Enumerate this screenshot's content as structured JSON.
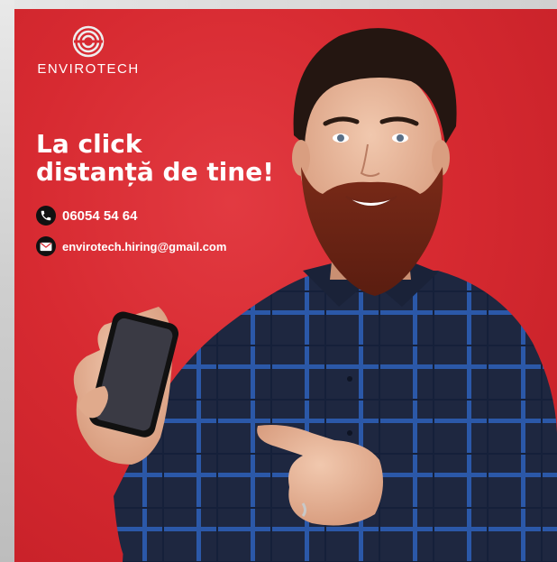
{
  "brand": {
    "name": "ENVIROTECH",
    "logo_icon": "concentric-circles-icon"
  },
  "headline": {
    "line1": "La click",
    "line2": "distanță de tine!"
  },
  "contacts": {
    "phone": {
      "icon": "phone-icon",
      "text": "06054 54 64"
    },
    "email": {
      "icon": "envelope-icon",
      "text": "envirotech.hiring@gmail.com"
    }
  },
  "colors": {
    "background_red": "#d72a31",
    "text": "#ffffff",
    "shirt": "#1f2a44",
    "shirt_stripe": "#2f5fb3"
  }
}
